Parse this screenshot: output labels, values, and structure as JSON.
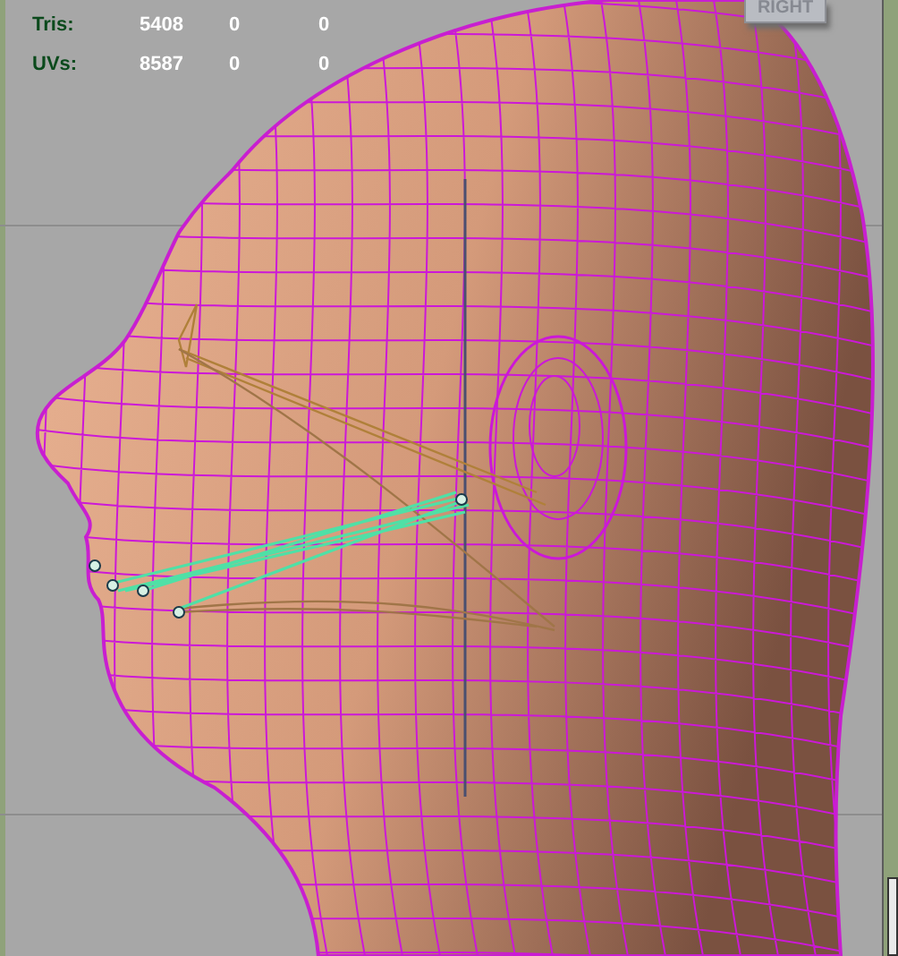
{
  "hud": {
    "rows": [
      {
        "label": "Tris:",
        "values": [
          "5408",
          "0",
          "0"
        ]
      },
      {
        "label": "UVs:",
        "values": [
          "8587",
          "0",
          "0"
        ]
      }
    ]
  },
  "view_cube": {
    "label": "RIGHT"
  }
}
